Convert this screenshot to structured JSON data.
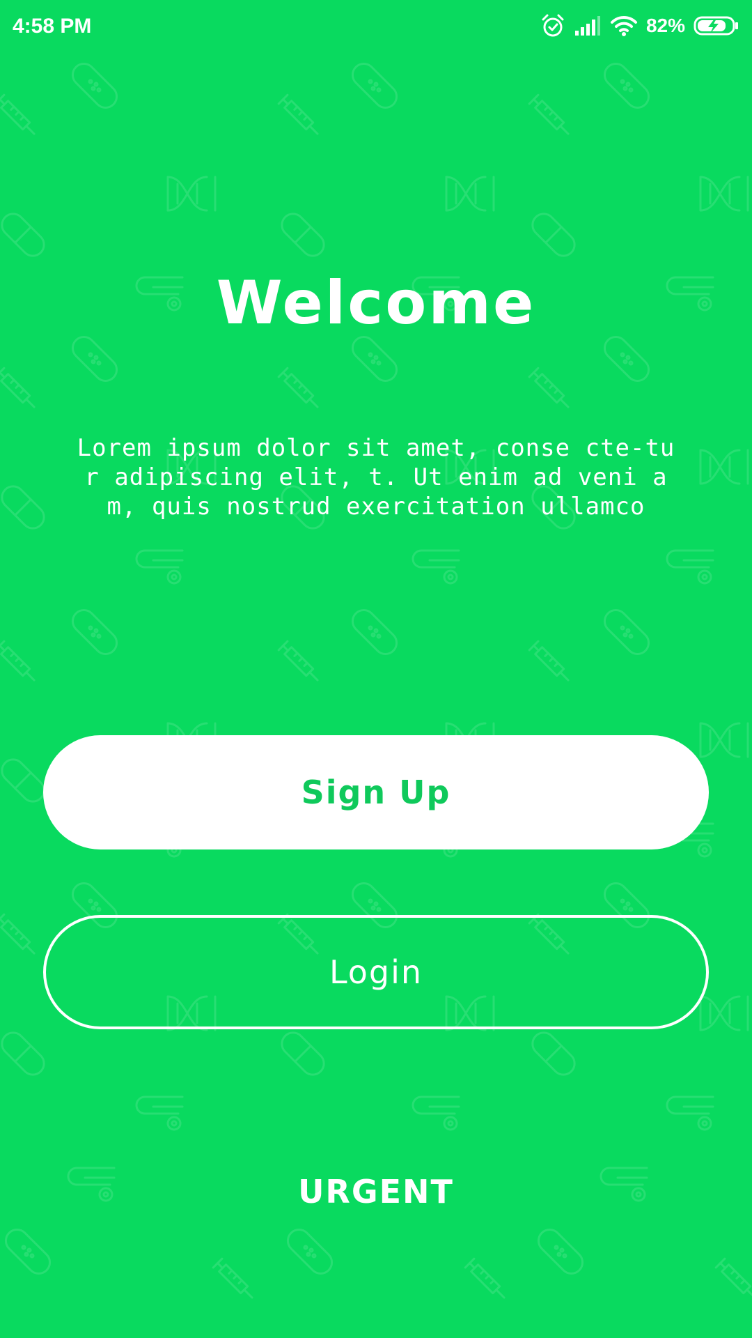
{
  "status_bar": {
    "time": "4:58 PM",
    "battery_percent": "82%",
    "icons": [
      "alarm-icon",
      "cellular-signal-icon",
      "wifi-icon",
      "battery-charging-icon"
    ]
  },
  "welcome": {
    "title": "Welcome",
    "description": "Lorem ipsum dolor sit amet, conse cte-tur adipiscing elit, t. Ut enim ad veni am, quis nostrud exercitation ullamco"
  },
  "buttons": {
    "signup_label": "Sign Up",
    "login_label": "Login"
  },
  "urgent_label": "URGENT",
  "background_pattern": {
    "icons": [
      "bandage-icon",
      "syringe-icon",
      "dna-icon",
      "pill-icon",
      "stethoscope-icon"
    ]
  },
  "colors": {
    "background": "#09DA5F",
    "accent_text": "#0FC95B",
    "white": "#FFFFFF"
  }
}
